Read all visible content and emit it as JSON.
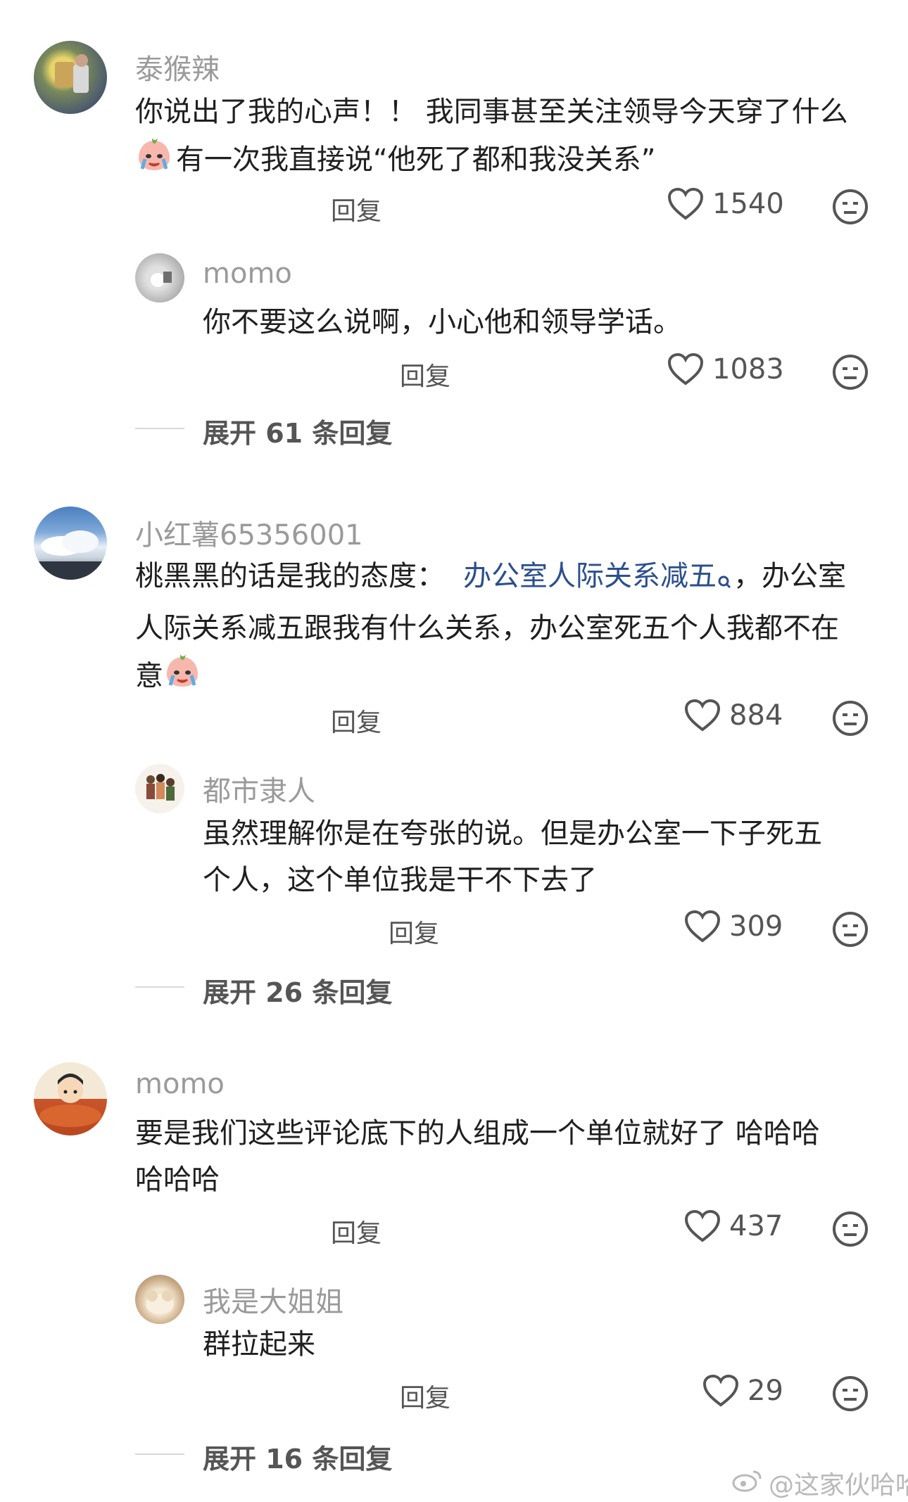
{
  "comments": [
    {
      "author": "泰猴辣",
      "line1": "你说出了我的心声！！ 我同事甚至关注领导今天穿了什么",
      "line2": "有一次我直接说“他死了都和我没关系”",
      "reply_label": "回复",
      "likes": "1540",
      "sub": {
        "author": "momo",
        "text": "你不要这么说啊，小心他和领导学话。",
        "reply_label": "回复",
        "likes": "1083"
      },
      "expand": "展开 61 条回复"
    },
    {
      "author": "小红薯65356001",
      "line1_pre": "桃黑黑的话是我的态度：",
      "line1_link": "办公室人际关系减五",
      "line1_post": "，办公室",
      "line2": "人际关系减五跟我有什么关系，办公室死五个人我都不在",
      "line3": "意",
      "reply_label": "回复",
      "likes": "884",
      "sub": {
        "author": "都市隶人",
        "line1": "虽然理解你是在夸张的说。但是办公室一下子死五",
        "line2": "个人，这个单位我是干不下去了",
        "reply_label": "回复",
        "likes": "309"
      },
      "expand": "展开 26 条回复"
    },
    {
      "author": "momo",
      "line1": "要是我们这些评论底下的人组成一个单位就好了 哈哈哈",
      "line2": "哈哈哈",
      "reply_label": "回复",
      "likes": "437",
      "sub": {
        "author": "我是大姐姐",
        "text": "群拉起来",
        "reply_label": "回复",
        "likes": "29"
      },
      "expand": "展开 16 条回复"
    }
  ],
  "watermark": "@这家伙哈哈",
  "icons": [
    "heart-icon",
    "meh-face-icon",
    "crying-emoji-icon",
    "search-link-icon",
    "weibo-logo-icon"
  ]
}
